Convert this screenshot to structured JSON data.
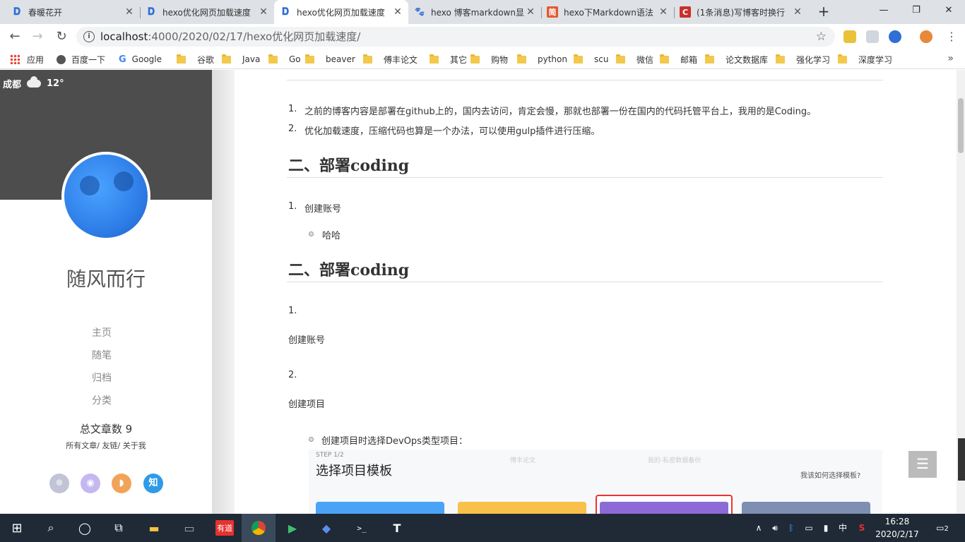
{
  "browser": {
    "tabs": [
      {
        "title": "春暖花开",
        "icon": "doc-icon",
        "color": "#2f6fd6"
      },
      {
        "title": "hexo优化网页加载速度",
        "icon": "doc-icon",
        "color": "#2f6fd6"
      },
      {
        "title": "hexo优化网页加载速度",
        "icon": "doc-icon",
        "color": "#2f6fd6",
        "active": true
      },
      {
        "title": "hexo 博客markdown显",
        "icon": "paw-icon",
        "color": "#2f6fd6"
      },
      {
        "title": "hexo下Markdown语法",
        "icon": "jianshu-icon",
        "color": "#e4572e",
        "glyph": "简"
      },
      {
        "title": "(1条消息)写博客时换行",
        "icon": "csdn-icon",
        "color": "#c9302c",
        "glyph": "C"
      }
    ],
    "new_tab": "+",
    "window_controls": {
      "minimize": "—",
      "restore": "❐",
      "close": "✕"
    },
    "url": {
      "host": "localhost",
      "path": ":4000/2020/02/17/hexo优化网页加载速度/"
    },
    "bookmarks": [
      {
        "label": "应用",
        "icon": "apps-icon"
      },
      {
        "label": "百度一下",
        "icon": "globe-icon"
      },
      {
        "label": "Google",
        "icon": "google-icon"
      },
      {
        "label": "谷歌",
        "icon": "folder-icon"
      },
      {
        "label": "Java",
        "icon": "folder-icon"
      },
      {
        "label": "Go",
        "icon": "folder-icon"
      },
      {
        "label": "beaver",
        "icon": "folder-icon"
      },
      {
        "label": "傅丰论文",
        "icon": "folder-icon"
      },
      {
        "label": "其它",
        "icon": "folder-icon"
      },
      {
        "label": "购物",
        "icon": "folder-icon"
      },
      {
        "label": "python",
        "icon": "folder-icon"
      },
      {
        "label": "scu",
        "icon": "folder-icon"
      },
      {
        "label": "微信",
        "icon": "folder-icon"
      },
      {
        "label": "邮箱",
        "icon": "folder-icon"
      },
      {
        "label": "论文数据库",
        "icon": "folder-icon"
      },
      {
        "label": "强化学习",
        "icon": "folder-icon"
      },
      {
        "label": "深度学习",
        "icon": "folder-icon"
      }
    ],
    "bookmarks_more": "»"
  },
  "sidebar": {
    "weather": {
      "city": "成都",
      "temp": "12°"
    },
    "blog_title": "随风而行",
    "menu": [
      "主页",
      "随笔",
      "归档",
      "分类"
    ],
    "article_count": "总文章数 9",
    "subnav": "所有文章/  友链/  关于我",
    "social": [
      {
        "icon": "github-icon",
        "color": "#c0c4d6",
        "glyph": "⌾"
      },
      {
        "icon": "weibo-icon",
        "color": "#c5b8f0",
        "glyph": "◉"
      },
      {
        "icon": "rss-icon",
        "color": "#f2a35a",
        "glyph": "◗"
      },
      {
        "icon": "zhihu-icon",
        "color": "#2f9be8",
        "glyph": "知"
      }
    ]
  },
  "content": {
    "list1": [
      {
        "num": "1.",
        "text": "之前的博客内容是部署在github上的，国内去访问，肯定会慢，那就也部署一份在国内的代码托管平台上，我用的是Coding。"
      },
      {
        "num": "2.",
        "text": "优化加载速度，压缩代码也算是一个办法，可以使用gulp插件进行压缩。"
      }
    ],
    "heading1": "二、部署coding",
    "list2_num": "1.",
    "list2_text": "创建账号",
    "list2_bullet": "哈哈",
    "heading2": "二、部署coding",
    "list3": [
      {
        "num": "1.",
        "text": "创建账号"
      },
      {
        "num": "2.",
        "text": "创建项目"
      }
    ],
    "bullet3": "创建项目时选择DevOps类型项目：",
    "embedded": {
      "step": "STEP 1/2",
      "title": "选择项目模板",
      "help": "我该如何选择模板?",
      "faint_cards": [
        "傅丰论文",
        "我的-私密数据备份"
      ],
      "template_colors": [
        "#4aa3f5",
        "#f7c14a",
        "#8e6ad6",
        "#7f8fb3"
      ]
    }
  },
  "fab_icon": "menu-icon",
  "taskbar": {
    "apps": [
      {
        "name": "start-icon",
        "glyph": "⊞"
      },
      {
        "name": "search-icon",
        "glyph": "⌕"
      },
      {
        "name": "cortana-icon",
        "glyph": "◯"
      },
      {
        "name": "task-view-icon",
        "glyph": "⧉"
      },
      {
        "name": "file-explorer-icon",
        "glyph": "▬",
        "color": "#f4c542"
      },
      {
        "name": "terminal-icon",
        "glyph": "▭"
      },
      {
        "name": "youdao-icon",
        "glyph": "有道",
        "color": "#e8312f"
      },
      {
        "name": "chrome-icon",
        "glyph": "◍",
        "active": true
      },
      {
        "name": "media-player-icon",
        "glyph": "▶",
        "color": "#3fbf6e"
      },
      {
        "name": "feishu-icon",
        "glyph": "◆",
        "color": "#5a8dee"
      },
      {
        "name": "console-icon",
        "glyph": ">_"
      },
      {
        "name": "typora-icon",
        "glyph": "T"
      }
    ],
    "tray": {
      "arrow": "∧",
      "volume": "🔊︎",
      "bluetooth": "ᛒ",
      "network": "▭",
      "power": "▮",
      "ime": "中",
      "sogou": "S"
    },
    "time": "16:28",
    "date": "2020/2/17",
    "notifications": "2"
  }
}
